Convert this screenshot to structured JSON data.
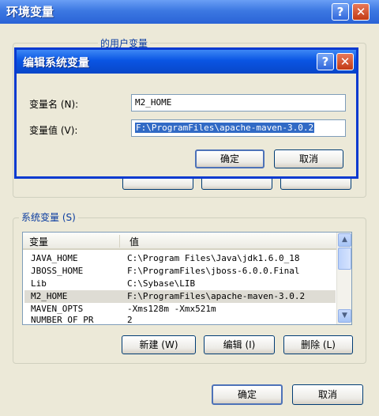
{
  "outer": {
    "title": "环境变量",
    "user_group_label": "的用户变量",
    "system_group_label": "系统变量 (S)",
    "ok_label": "确定",
    "cancel_label": "取消"
  },
  "dialog": {
    "title": "编辑系统变量",
    "name_label": "变量名 (N):",
    "name_value": "M2_HOME",
    "value_label": "变量值 (V):",
    "value_value": "F:\\ProgramFiles\\apache-maven-3.0.2",
    "ok_label": "确定",
    "cancel_label": "取消"
  },
  "system_vars": {
    "columns": [
      "变量",
      "值"
    ],
    "rows": [
      {
        "name": "JAVA_HOME",
        "value": "C:\\Program Files\\Java\\jdk1.6.0_18"
      },
      {
        "name": "JBOSS_HOME",
        "value": "F:\\ProgramFiles\\jboss-6.0.0.Final"
      },
      {
        "name": "Lib",
        "value": "C:\\Sybase\\LIB"
      },
      {
        "name": "M2_HOME",
        "value": "F:\\ProgramFiles\\apache-maven-3.0.2"
      },
      {
        "name": "MAVEN_OPTS",
        "value": "-Xms128m -Xmx521m"
      },
      {
        "name": "NUMBER_OF_PR",
        "value": "2"
      }
    ],
    "new_label": "新建 (W)",
    "edit_label": "编辑 (I)",
    "delete_label": "删除 (L)"
  },
  "colors": {
    "title_blue": "#0a55e3",
    "selection": "#316ac5",
    "window_bg": "#ece9d8"
  }
}
